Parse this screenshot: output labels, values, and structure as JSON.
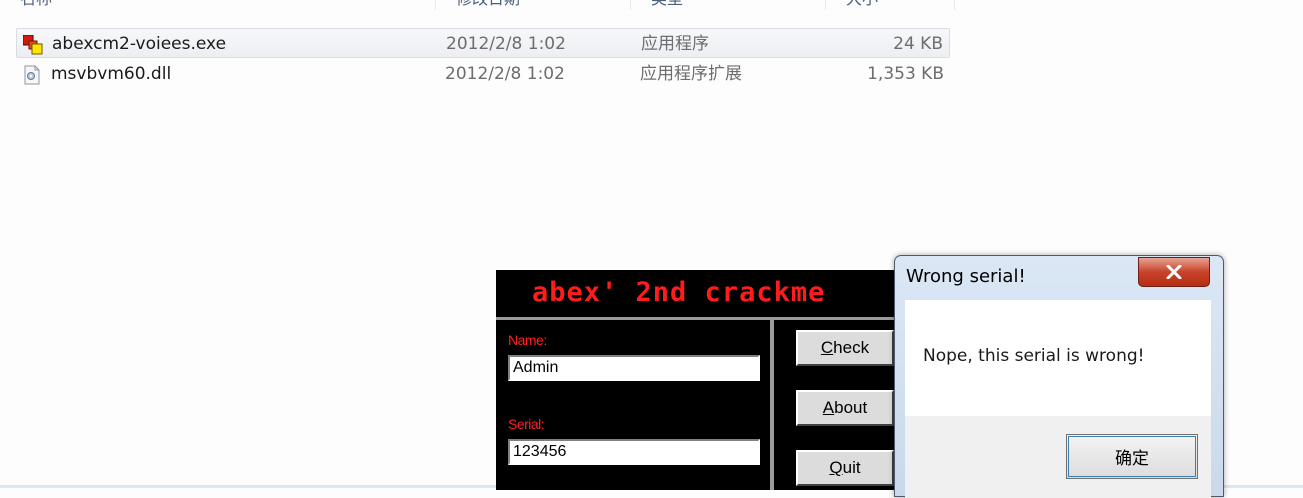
{
  "explorer": {
    "columns": [
      {
        "label": "名称"
      },
      {
        "label": "修改日期"
      },
      {
        "label": "类型"
      },
      {
        "label": "大小"
      }
    ],
    "files": [
      {
        "name": "abexcm2-voiees.exe",
        "date": "2012/2/8 1:02",
        "type": "应用程序",
        "size": "24 KB",
        "icon": "exe-app-icon",
        "selected": true
      },
      {
        "name": "msvbvm60.dll",
        "date": "2012/2/8 1:02",
        "type": "应用程序扩展",
        "size": "1,353 KB",
        "icon": "dll-file-icon",
        "selected": false
      }
    ]
  },
  "crackme": {
    "title": "abex' 2nd crackme",
    "name_label": "Name:",
    "name_value": "Admin",
    "serial_label": "Serial:",
    "serial_value": "123456",
    "buttons": {
      "check": {
        "prefix": "",
        "underline": "C",
        "rest": "heck"
      },
      "about": {
        "prefix": "",
        "underline": "A",
        "rest": "bout"
      },
      "quit": {
        "prefix": "",
        "underline": "Q",
        "rest": "uit"
      }
    },
    "colors": {
      "title": "#ff1c1c",
      "labels": "#ff2020",
      "background": "#000000"
    }
  },
  "message_box": {
    "title": "Wrong serial!",
    "text": "Nope, this serial is wrong!",
    "ok_label": "确定",
    "close_icon": "close-icon"
  }
}
